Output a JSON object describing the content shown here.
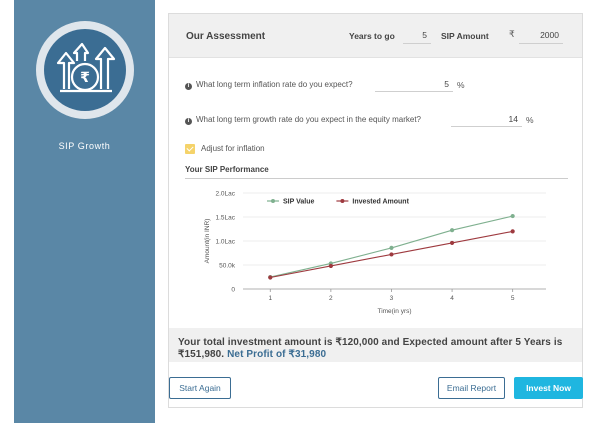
{
  "sidebar": {
    "title": "SIP Growth",
    "logo_icon": "sip-growth-rupee-icon"
  },
  "header": {
    "title": "Our Assessment",
    "years_label": "Years to go",
    "years_value": "5",
    "amount_label": "SIP Amount",
    "currency_symbol": "₹",
    "amount_value": "2000"
  },
  "questions": {
    "inflation": {
      "text": "What long term inflation rate do you expect?",
      "value": "5",
      "unit": "%"
    },
    "growth": {
      "text": "What long term growth rate do you expect in the equity market?",
      "value": "14",
      "unit": "%"
    }
  },
  "adjust_inflation": {
    "label": "Adjust for inflation",
    "checked": true
  },
  "performance_title": "Your SIP Performance",
  "chart_data": {
    "type": "line",
    "x": [
      1,
      2,
      3,
      4,
      5
    ],
    "series": [
      {
        "name": "SIP Value",
        "color": "#7fb08f",
        "values": [
          24800,
          53200,
          85600,
          122500,
          151980
        ]
      },
      {
        "name": "Invested Amount",
        "color": "#9e3a3f",
        "values": [
          24000,
          48000,
          72000,
          96000,
          120000
        ]
      }
    ],
    "xlabel": "Time(in yrs)",
    "ylabel": "Amount(in INR)",
    "ylim": [
      0,
      200000
    ],
    "ytick_values": [
      0,
      50000,
      100000,
      150000,
      200000
    ],
    "ytick_labels": [
      "0",
      "50.0k",
      "1.0Lac",
      "1.5Lac",
      "2.0Lac"
    ],
    "xtick_labels": [
      "1",
      "2",
      "3",
      "4",
      "5"
    ],
    "grid": true,
    "legend": "top-left"
  },
  "result": {
    "text": "Your total investment amount is ₹120,000 and Expected amount after 5 Years is ₹151,980.",
    "profit": "Net Profit of ₹31,980"
  },
  "buttons": {
    "start_again": "Start Again",
    "email_report": "Email Report",
    "invest_now": "Invest Now"
  }
}
